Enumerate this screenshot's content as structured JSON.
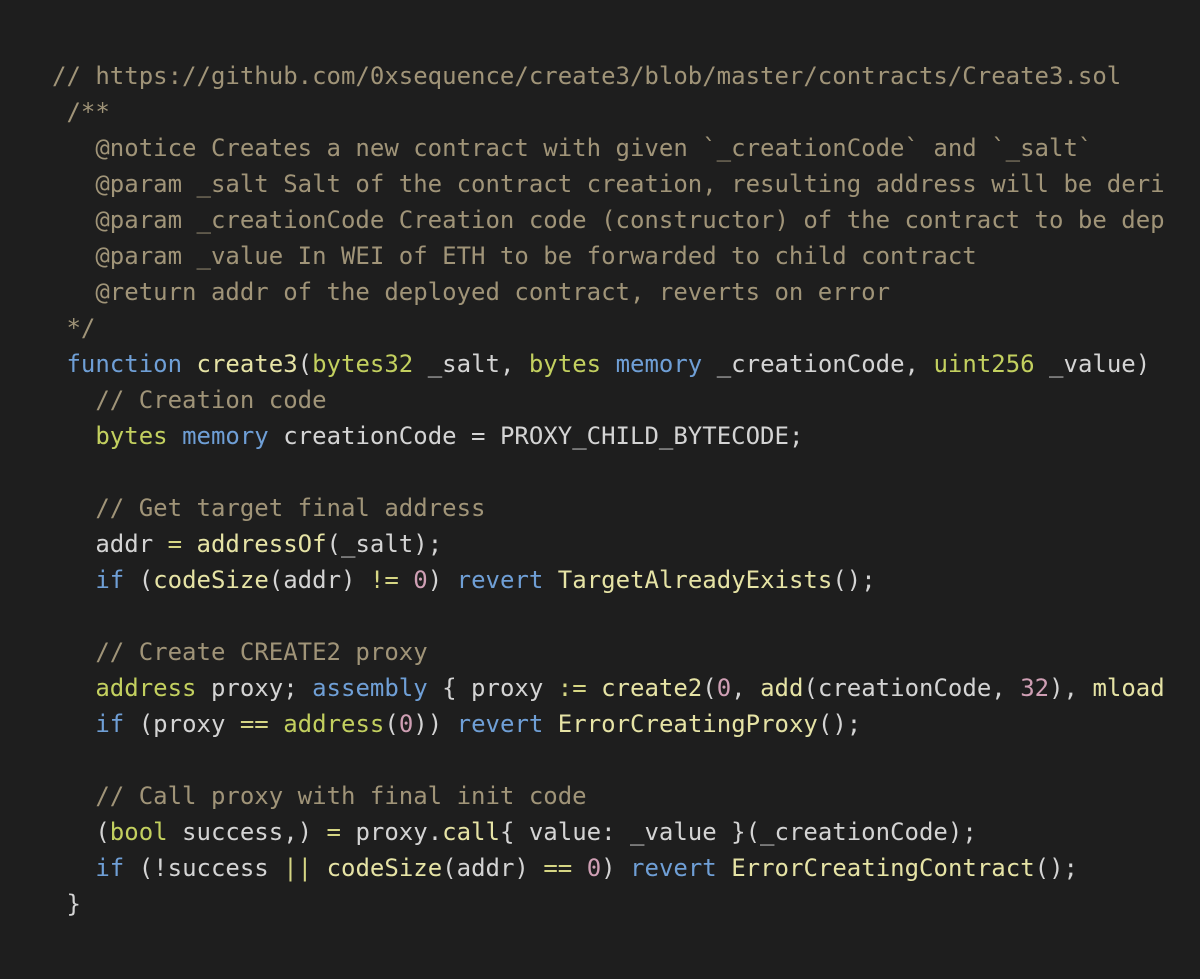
{
  "colors": {
    "background": "#1e1e1e",
    "plain": "#d4d4d4",
    "comment": "#a09478",
    "keyword": "#6f9fd6",
    "type": "#c3d05f",
    "function": "#e6e3a5",
    "number": "#cf9fb4",
    "operator": "#d6d684"
  },
  "editor": {
    "lines": [
      {
        "tokens": [
          {
            "text": "// https://github.com/0xsequence/create3/blob/master/contracts/Create3.sol",
            "kind": "comment"
          }
        ]
      },
      {
        "tokens": [
          {
            "text": " /**",
            "kind": "comment"
          }
        ]
      },
      {
        "tokens": [
          {
            "text": "   @notice Creates a new contract with given `_creationCode` and `_salt`",
            "kind": "comment"
          }
        ]
      },
      {
        "tokens": [
          {
            "text": "   @param _salt Salt of the contract creation, resulting address will be deri",
            "kind": "comment"
          }
        ]
      },
      {
        "tokens": [
          {
            "text": "   @param _creationCode Creation code (constructor) of the contract to be dep",
            "kind": "comment"
          }
        ]
      },
      {
        "tokens": [
          {
            "text": "   @param _value In WEI of ETH to be forwarded to child contract",
            "kind": "comment"
          }
        ]
      },
      {
        "tokens": [
          {
            "text": "   @return addr of the deployed contract, reverts on error",
            "kind": "comment"
          }
        ]
      },
      {
        "tokens": [
          {
            "text": " */",
            "kind": "comment"
          }
        ]
      },
      {
        "tokens": [
          {
            "text": " ",
            "kind": "plain"
          },
          {
            "text": "function",
            "kind": "keyword"
          },
          {
            "text": " ",
            "kind": "plain"
          },
          {
            "text": "create3",
            "kind": "function"
          },
          {
            "text": "(",
            "kind": "plain"
          },
          {
            "text": "bytes32",
            "kind": "type"
          },
          {
            "text": " _salt, ",
            "kind": "plain"
          },
          {
            "text": "bytes",
            "kind": "type"
          },
          {
            "text": " ",
            "kind": "plain"
          },
          {
            "text": "memory",
            "kind": "keyword"
          },
          {
            "text": " _creationCode, ",
            "kind": "plain"
          },
          {
            "text": "uint256",
            "kind": "type"
          },
          {
            "text": " _value)",
            "kind": "plain"
          }
        ]
      },
      {
        "tokens": [
          {
            "text": "   // Creation code",
            "kind": "comment"
          }
        ]
      },
      {
        "tokens": [
          {
            "text": "   ",
            "kind": "plain"
          },
          {
            "text": "bytes",
            "kind": "type"
          },
          {
            "text": " ",
            "kind": "plain"
          },
          {
            "text": "memory",
            "kind": "keyword"
          },
          {
            "text": " creationCode = PROXY_CHILD_BYTECODE;",
            "kind": "plain"
          }
        ]
      },
      {
        "tokens": []
      },
      {
        "tokens": [
          {
            "text": "   // Get target final address",
            "kind": "comment"
          }
        ]
      },
      {
        "tokens": [
          {
            "text": "   addr ",
            "kind": "plain"
          },
          {
            "text": "=",
            "kind": "operator"
          },
          {
            "text": " ",
            "kind": "plain"
          },
          {
            "text": "addressOf",
            "kind": "function"
          },
          {
            "text": "(_salt);",
            "kind": "plain"
          }
        ]
      },
      {
        "tokens": [
          {
            "text": "   ",
            "kind": "plain"
          },
          {
            "text": "if",
            "kind": "keyword"
          },
          {
            "text": " (",
            "kind": "plain"
          },
          {
            "text": "codeSize",
            "kind": "function"
          },
          {
            "text": "(addr) ",
            "kind": "plain"
          },
          {
            "text": "!=",
            "kind": "operator"
          },
          {
            "text": " ",
            "kind": "plain"
          },
          {
            "text": "0",
            "kind": "number"
          },
          {
            "text": ") ",
            "kind": "plain"
          },
          {
            "text": "revert",
            "kind": "keyword"
          },
          {
            "text": " ",
            "kind": "plain"
          },
          {
            "text": "TargetAlreadyExists",
            "kind": "function"
          },
          {
            "text": "();",
            "kind": "plain"
          }
        ]
      },
      {
        "tokens": []
      },
      {
        "tokens": [
          {
            "text": "   // Create CREATE2 proxy",
            "kind": "comment"
          }
        ]
      },
      {
        "tokens": [
          {
            "text": "   ",
            "kind": "plain"
          },
          {
            "text": "address",
            "kind": "type"
          },
          {
            "text": " proxy; ",
            "kind": "plain"
          },
          {
            "text": "assembly",
            "kind": "keyword"
          },
          {
            "text": " { proxy ",
            "kind": "plain"
          },
          {
            "text": ":=",
            "kind": "operator"
          },
          {
            "text": " ",
            "kind": "plain"
          },
          {
            "text": "create2",
            "kind": "function"
          },
          {
            "text": "(",
            "kind": "plain"
          },
          {
            "text": "0",
            "kind": "number"
          },
          {
            "text": ", ",
            "kind": "plain"
          },
          {
            "text": "add",
            "kind": "function"
          },
          {
            "text": "(creationCode, ",
            "kind": "plain"
          },
          {
            "text": "32",
            "kind": "number"
          },
          {
            "text": "), ",
            "kind": "plain"
          },
          {
            "text": "mload",
            "kind": "function"
          }
        ]
      },
      {
        "tokens": [
          {
            "text": "   ",
            "kind": "plain"
          },
          {
            "text": "if",
            "kind": "keyword"
          },
          {
            "text": " (proxy ",
            "kind": "plain"
          },
          {
            "text": "==",
            "kind": "operator"
          },
          {
            "text": " ",
            "kind": "plain"
          },
          {
            "text": "address",
            "kind": "type"
          },
          {
            "text": "(",
            "kind": "plain"
          },
          {
            "text": "0",
            "kind": "number"
          },
          {
            "text": ")) ",
            "kind": "plain"
          },
          {
            "text": "revert",
            "kind": "keyword"
          },
          {
            "text": " ",
            "kind": "plain"
          },
          {
            "text": "ErrorCreatingProxy",
            "kind": "function"
          },
          {
            "text": "();",
            "kind": "plain"
          }
        ]
      },
      {
        "tokens": []
      },
      {
        "tokens": [
          {
            "text": "   // Call proxy with final init code",
            "kind": "comment"
          }
        ]
      },
      {
        "tokens": [
          {
            "text": "   (",
            "kind": "plain"
          },
          {
            "text": "bool",
            "kind": "type"
          },
          {
            "text": " success,) ",
            "kind": "plain"
          },
          {
            "text": "=",
            "kind": "operator"
          },
          {
            "text": " proxy.",
            "kind": "plain"
          },
          {
            "text": "call",
            "kind": "function"
          },
          {
            "text": "{ value: _value }(_creationCode);",
            "kind": "plain"
          }
        ]
      },
      {
        "tokens": [
          {
            "text": "   ",
            "kind": "plain"
          },
          {
            "text": "if",
            "kind": "keyword"
          },
          {
            "text": " (!success ",
            "kind": "plain"
          },
          {
            "text": "||",
            "kind": "operator"
          },
          {
            "text": " ",
            "kind": "plain"
          },
          {
            "text": "codeSize",
            "kind": "function"
          },
          {
            "text": "(addr) ",
            "kind": "plain"
          },
          {
            "text": "==",
            "kind": "operator"
          },
          {
            "text": " ",
            "kind": "plain"
          },
          {
            "text": "0",
            "kind": "number"
          },
          {
            "text": ") ",
            "kind": "plain"
          },
          {
            "text": "revert",
            "kind": "keyword"
          },
          {
            "text": " ",
            "kind": "plain"
          },
          {
            "text": "ErrorCreatingContract",
            "kind": "function"
          },
          {
            "text": "();",
            "kind": "plain"
          }
        ]
      },
      {
        "tokens": [
          {
            "text": " }",
            "kind": "plain"
          }
        ]
      }
    ]
  }
}
